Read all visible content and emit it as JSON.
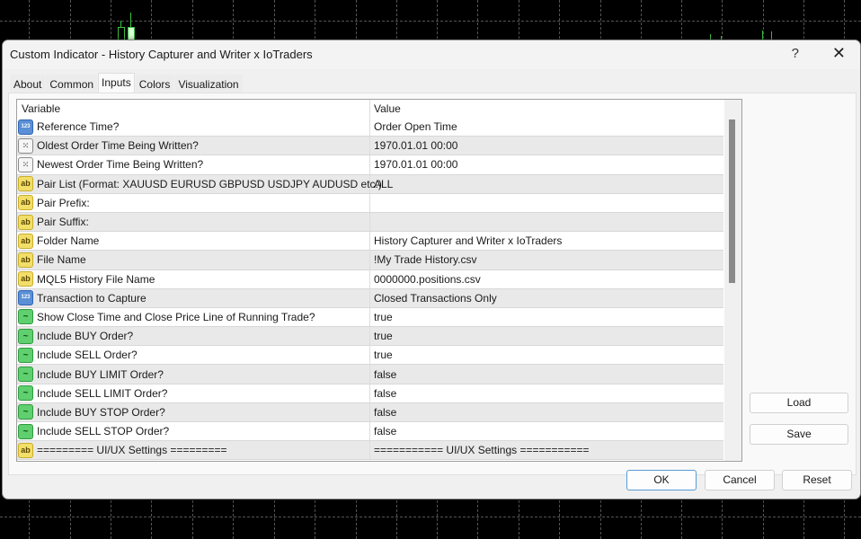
{
  "window": {
    "title": "Custom Indicator - History Capturer and Writer x IoTraders",
    "help_label": "?",
    "close_label": "✕"
  },
  "tabs": [
    {
      "label": "About"
    },
    {
      "label": "Common"
    },
    {
      "label": "Inputs",
      "active": true
    },
    {
      "label": "Colors"
    },
    {
      "label": "Visualization"
    }
  ],
  "table": {
    "headers": {
      "variable": "Variable",
      "value": "Value"
    },
    "rows": [
      {
        "icon": "number-icon",
        "icon_glyph": "123",
        "type": "num",
        "variable": "Reference Time?",
        "value": "Order Open Time"
      },
      {
        "icon": "datetime-icon",
        "icon_glyph": "⁙",
        "type": "dt",
        "variable": "Oldest Order Time Being Written?",
        "value": "1970.01.01 00:00"
      },
      {
        "icon": "datetime-icon",
        "icon_glyph": "⁙",
        "type": "dt",
        "variable": "Newest Order Time Being Written?",
        "value": "1970.01.01 00:00"
      },
      {
        "icon": "string-icon",
        "icon_glyph": "ab",
        "type": "str",
        "variable": "Pair List (Format: XAUUSD EURUSD GBPUSD USDJPY AUDUSD etc.)",
        "value": "ALL"
      },
      {
        "icon": "string-icon",
        "icon_glyph": "ab",
        "type": "str",
        "variable": "Pair Prefix:",
        "value": ""
      },
      {
        "icon": "string-icon",
        "icon_glyph": "ab",
        "type": "str",
        "variable": "Pair Suffix:",
        "value": ""
      },
      {
        "icon": "string-icon",
        "icon_glyph": "ab",
        "type": "str",
        "variable": "Folder Name",
        "value": "History Capturer and Writer x IoTraders"
      },
      {
        "icon": "string-icon",
        "icon_glyph": "ab",
        "type": "str",
        "variable": "File Name",
        "value": "!My Trade History.csv"
      },
      {
        "icon": "string-icon",
        "icon_glyph": "ab",
        "type": "str",
        "variable": "MQL5 History File Name",
        "value": "0000000.positions.csv"
      },
      {
        "icon": "number-icon",
        "icon_glyph": "123",
        "type": "num",
        "variable": "Transaction to Capture",
        "value": "Closed Transactions Only"
      },
      {
        "icon": "boolean-icon",
        "icon_glyph": "~",
        "type": "bool",
        "variable": "Show Close Time and Close Price Line of Running Trade?",
        "value": "true"
      },
      {
        "icon": "boolean-icon",
        "icon_glyph": "~",
        "type": "bool",
        "variable": "Include BUY Order?",
        "value": "true"
      },
      {
        "icon": "boolean-icon",
        "icon_glyph": "~",
        "type": "bool",
        "variable": "Include SELL Order?",
        "value": "true"
      },
      {
        "icon": "boolean-icon",
        "icon_glyph": "~",
        "type": "bool",
        "variable": "Include BUY LIMIT Order?",
        "value": "false"
      },
      {
        "icon": "boolean-icon",
        "icon_glyph": "~",
        "type": "bool",
        "variable": "Include SELL LIMIT Order?",
        "value": "false"
      },
      {
        "icon": "boolean-icon",
        "icon_glyph": "~",
        "type": "bool",
        "variable": "Include BUY STOP Order?",
        "value": "false"
      },
      {
        "icon": "boolean-icon",
        "icon_glyph": "~",
        "type": "bool",
        "variable": "Include SELL STOP Order?",
        "value": "false"
      },
      {
        "icon": "string-icon",
        "icon_glyph": "ab",
        "type": "str",
        "variable": "========= UI/UX Settings =========",
        "value": "=========== UI/UX Settings ==========="
      }
    ]
  },
  "side_buttons": {
    "load": "Load",
    "save": "Save"
  },
  "footer_buttons": {
    "ok": "OK",
    "cancel": "Cancel",
    "reset": "Reset"
  }
}
